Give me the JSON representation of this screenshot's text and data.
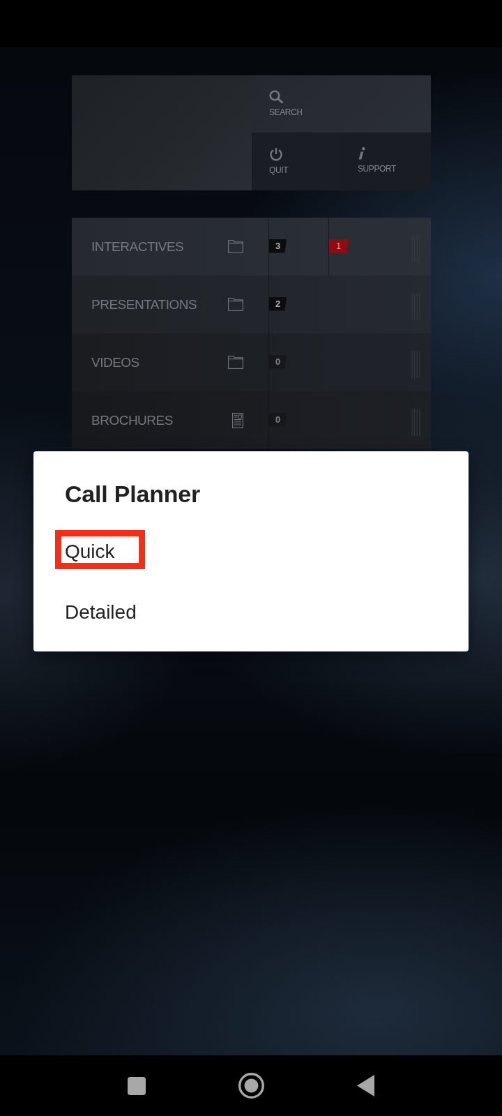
{
  "header_tiles": [
    {
      "kind": "search",
      "label": "SEARCH"
    },
    {
      "kind": "quit",
      "label": "QUIT"
    },
    {
      "kind": "support",
      "label": "SUPPORT"
    }
  ],
  "categories": [
    {
      "kind": "folder",
      "label": "INTERACTIVES",
      "count": "3",
      "count_highlighted": true,
      "alert": "1"
    },
    {
      "kind": "folder",
      "label": "PRESENTATIONS",
      "count": "2",
      "count_highlighted": true
    },
    {
      "kind": "folder",
      "label": "VIDEOS",
      "count": "0",
      "count_highlighted": false
    },
    {
      "kind": "document",
      "label": "BROCHURES",
      "count": "0",
      "count_highlighted": false
    }
  ],
  "dialog": {
    "title": "Call Planner",
    "options": [
      {
        "label": "Quick",
        "selected": true
      },
      {
        "label": "Detailed",
        "selected": false
      }
    ]
  }
}
